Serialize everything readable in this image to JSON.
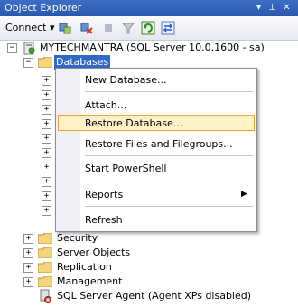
{
  "window": {
    "title": "Object Explorer",
    "pin_glyph": "▾",
    "pin2_glyph": "⊥",
    "close_glyph": "✕"
  },
  "toolbar": {
    "connect_label": "Connect ▾"
  },
  "tree": {
    "server": "MYTECHMANTRA (SQL Server 10.0.1600 - sa)",
    "databases": "Databases",
    "security": "Security",
    "server_objects": "Server Objects",
    "replication": "Replication",
    "management": "Management",
    "agent": "SQL Server Agent (Agent XPs disabled)"
  },
  "context_menu": {
    "items": [
      "New Database...",
      "Attach...",
      "Restore Database...",
      "Restore Files and Filegroups...",
      "Start PowerShell",
      "Reports",
      "Refresh"
    ],
    "submenu_arrow": "▶"
  },
  "colors": {
    "title_bar": "#2a57ad",
    "selection": "#3169c6",
    "hover_fill": "#fff2c6",
    "hover_border": "#e8a33a"
  }
}
